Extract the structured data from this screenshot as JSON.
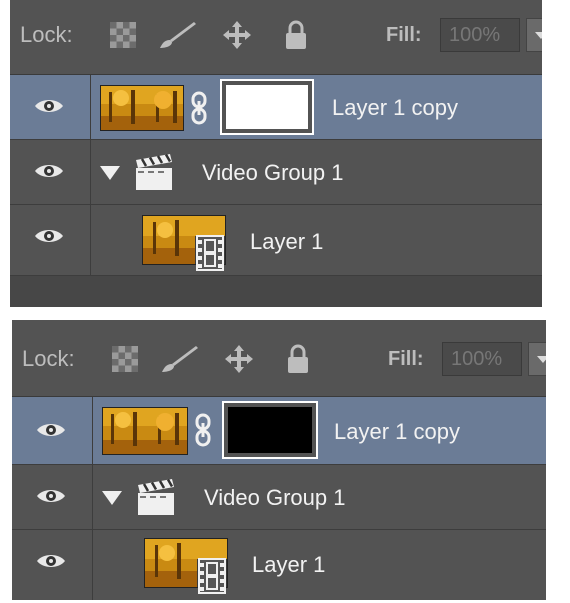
{
  "panels": [
    {
      "lock_label": "Lock:",
      "fill_label": "Fill:",
      "fill_value": "100%",
      "mask_color": "#ffffff",
      "layers": [
        {
          "name": "Layer 1 copy",
          "selected": true
        },
        {
          "name": "Video Group 1"
        },
        {
          "name": "Layer 1"
        }
      ]
    },
    {
      "lock_label": "Lock:",
      "fill_label": "Fill:",
      "fill_value": "100%",
      "mask_color": "#000000",
      "layers": [
        {
          "name": "Layer 1 copy",
          "selected": true
        },
        {
          "name": "Video Group 1"
        },
        {
          "name": "Layer 1"
        }
      ]
    }
  ],
  "icons": {
    "lock_transparent": "checkerboard-icon",
    "lock_pixels": "brush-icon",
    "lock_position": "move-arrows-icon",
    "lock_all": "padlock-icon",
    "visibility": "eye-icon",
    "expand": "triangle-down-icon",
    "group": "clapperboard-icon",
    "video_layer": "filmstrip-icon",
    "link": "chain-link-icon"
  },
  "colors": {
    "panel_bg": "#535353",
    "selected_row": "#6b7c96",
    "text": "#f2f2f2"
  }
}
